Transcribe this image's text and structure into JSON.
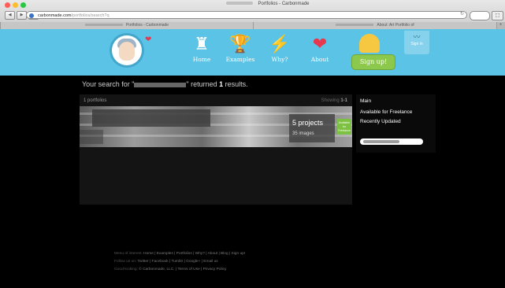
{
  "browser": {
    "window_title": "Portfolios - Carbonmade",
    "url_host": "carbonmade.com",
    "url_path": "/portfolios/search?q",
    "tabs": [
      {
        "label": "Portfolios - Carbonmade"
      },
      {
        "label": "About: Art Portfolio of"
      }
    ],
    "traffic_lights": [
      "#ff5f57",
      "#febc2e",
      "#28c840"
    ]
  },
  "nav": {
    "items": [
      {
        "label": "Home",
        "icon": "rook-icon",
        "glyph": "♜",
        "color": "#ffffff"
      },
      {
        "label": "Examples",
        "icon": "trophy-icon",
        "glyph": "🏆",
        "color": "#f2c12e"
      },
      {
        "label": "Why?",
        "icon": "lightning-icon",
        "glyph": "⚡",
        "color": "#3ad1a0"
      },
      {
        "label": "About",
        "icon": "heart-icon",
        "glyph": "❤",
        "color": "#e8384f"
      }
    ],
    "signup_label": "Sign up!",
    "signin_label": "Sign in"
  },
  "search": {
    "prefix": "Your search for \"",
    "suffix": "\" returned",
    "count": "1",
    "results_word": "results."
  },
  "results_panel": {
    "count_label": "1 portfolios",
    "showing_label": "Showing",
    "showing_range": "1-1",
    "card": {
      "projects": "5 projects",
      "images": "35 images",
      "tag": "Available for Freelance"
    }
  },
  "filters": {
    "main": "Main",
    "available": "Available for Freelance",
    "recent": "Recently Updated"
  },
  "footer": {
    "line1_lead": "Menu of interest:",
    "line1_links": "Home | Examples | Portfolios | Why? | About | Blog | Sign up!",
    "line2_lead": "Follow us on:",
    "line2_links": "Twitter | Facebook | Tumblr | Google+ | Email us",
    "line3_lead": "Good-looking:",
    "line3_links": "© Carbonmade, LLC. | Terms of Use | Privacy Policy"
  },
  "colors": {
    "header": "#5bc3e6",
    "signup": "#8cc84b",
    "page": "#000000"
  }
}
